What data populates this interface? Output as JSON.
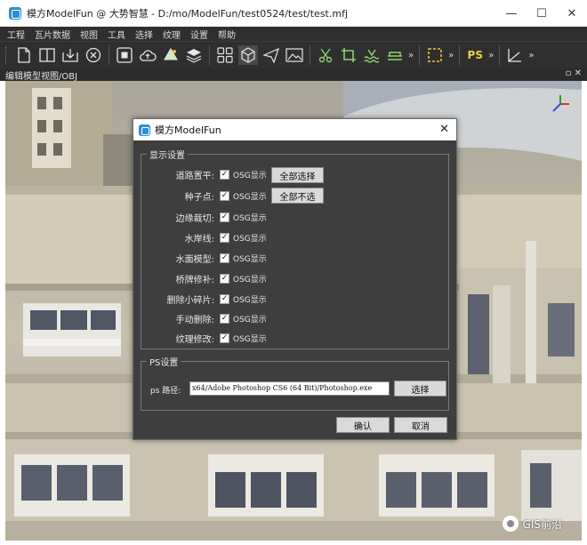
{
  "window": {
    "title": "模方ModelFun @ 大势智慧 - D:/mo/ModelFun/test0524/test/test.mfj",
    "minimize": "—",
    "maximize": "☐",
    "close": "✕"
  },
  "menu": {
    "items": [
      "工程",
      "瓦片数据",
      "视图",
      "工具",
      "选择",
      "纹理",
      "设置",
      "帮助"
    ]
  },
  "toolbar": {
    "ps_label": "PS",
    "more_glyph": "»"
  },
  "view": {
    "header": "编辑模型视图/OBJ",
    "header_buttons": "▫ ✕"
  },
  "dialog": {
    "title": "模方ModelFun",
    "close": "✕",
    "display_group": {
      "title": "显示设置",
      "options": [
        {
          "label": "道路置平",
          "checkbox_label": "OSG显示",
          "checked": true
        },
        {
          "label": "种子点",
          "checkbox_label": "OSG显示",
          "checked": true
        },
        {
          "label": "边缘裁切",
          "checkbox_label": "OSG显示",
          "checked": true
        },
        {
          "label": "水岸线",
          "checkbox_label": "OSG显示",
          "checked": true
        },
        {
          "label": "水面模型",
          "checkbox_label": "OSG显示",
          "checked": true
        },
        {
          "label": "桥牌修补",
          "checkbox_label": "OSG显示",
          "checked": true
        },
        {
          "label": "删除小碎片",
          "checkbox_label": "OSG显示",
          "checked": true
        },
        {
          "label": "手动删除",
          "checkbox_label": "OSG显示",
          "checked": true
        },
        {
          "label": "纹理修改",
          "checkbox_label": "OSG显示",
          "checked": true
        }
      ],
      "select_all": "全部选择",
      "select_none": "全部不选"
    },
    "ps_group": {
      "title": "PS设置",
      "path_label": "ps 路径:",
      "path_value": "x64/Adobe Photoshop CS6 (64 Bit)/Photoshop.exe",
      "browse": "选择"
    },
    "ok": "确认",
    "cancel": "取消"
  },
  "watermark": {
    "text": "GIS前沿"
  },
  "colors": {
    "dark_bg": "#2f2f2f",
    "dialog_bg": "#3e3e3e",
    "accent": "#2b8fd6"
  }
}
